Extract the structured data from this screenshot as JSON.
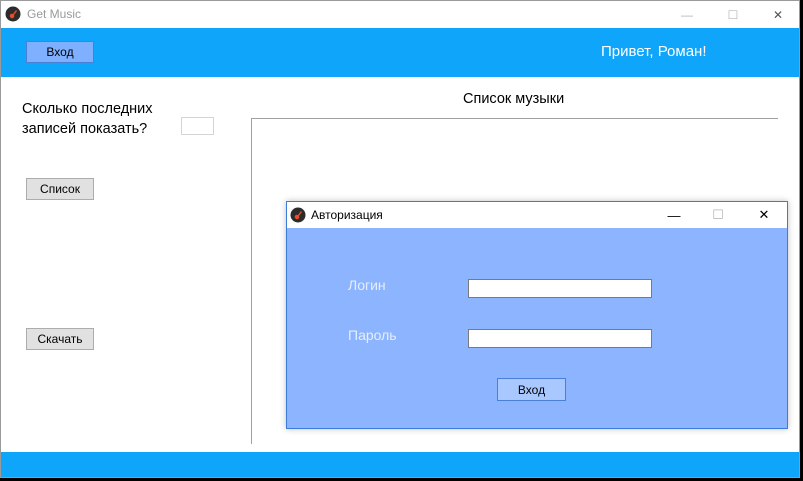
{
  "window": {
    "title": "Get Music",
    "minimize_glyph": "—",
    "maximize_glyph": "☐",
    "close_glyph": "✕"
  },
  "header": {
    "login_label": "Вход",
    "greeting": "Привет, Роман!"
  },
  "left_panel": {
    "count_label": "Сколько последних записей показать?",
    "count_value": "",
    "list_button": "Список",
    "download_button": "Скачать"
  },
  "music": {
    "title": "Список музыки",
    "items": []
  },
  "dialog": {
    "title": "Авторизация",
    "minimize_glyph": "—",
    "maximize_glyph": "☐",
    "close_glyph": "✕",
    "login_label": "Логин",
    "login_value": "",
    "password_label": "Пароль",
    "password_value": "",
    "enter_button": "Вход"
  },
  "colors": {
    "accent_blue": "#0ea5fb",
    "dialog_bg": "#8db4ff",
    "button_blue": "#7fb0ff"
  },
  "icons": {
    "app": "guitar-icon"
  }
}
